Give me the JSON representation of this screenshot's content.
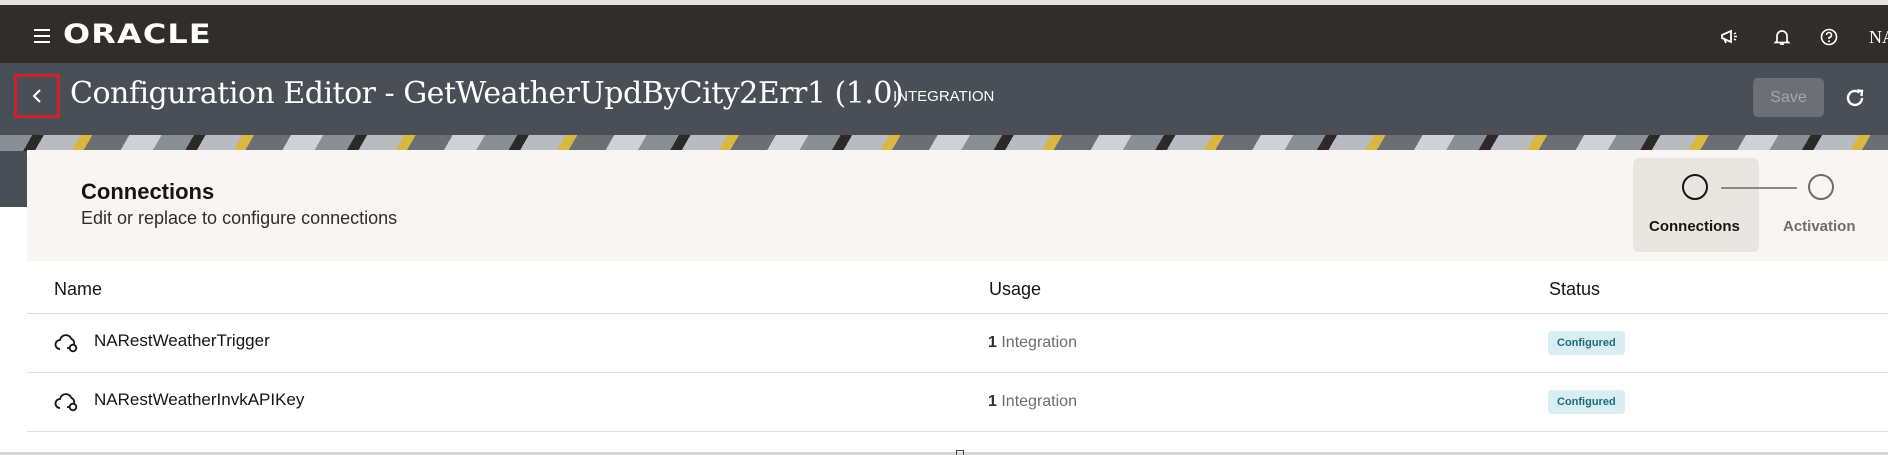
{
  "header": {
    "brand": "ORACLE",
    "user_initials": "NA",
    "icons": [
      "menu-icon",
      "announcement-icon",
      "bell-icon",
      "help-icon"
    ]
  },
  "titlebar": {
    "title": "Configuration Editor - GetWeatherUpdByCity2Err1 (1.0)",
    "type_label": "INTEGRATION",
    "save_label": "Save",
    "save_enabled": false
  },
  "section": {
    "title": "Connections",
    "subtitle": "Edit or replace to configure connections"
  },
  "stepper": {
    "steps": [
      {
        "label": "Connections",
        "active": true
      },
      {
        "label": "Activation",
        "active": false
      }
    ]
  },
  "table": {
    "columns": [
      "Name",
      "Usage",
      "Status"
    ],
    "rows": [
      {
        "name": "NARestWeatherTrigger",
        "usage_count": "1",
        "usage_label": "Integration",
        "status": "Configured"
      },
      {
        "name": "NARestWeatherInvkAPIKey",
        "usage_count": "1",
        "usage_label": "Integration",
        "status": "Configured"
      }
    ]
  },
  "colors": {
    "topbar": "#312d2a",
    "titlebar": "#4a4f57",
    "badge_bg": "#d9eef2",
    "badge_text": "#1e6a78",
    "focus_outline": "#d0202a"
  }
}
